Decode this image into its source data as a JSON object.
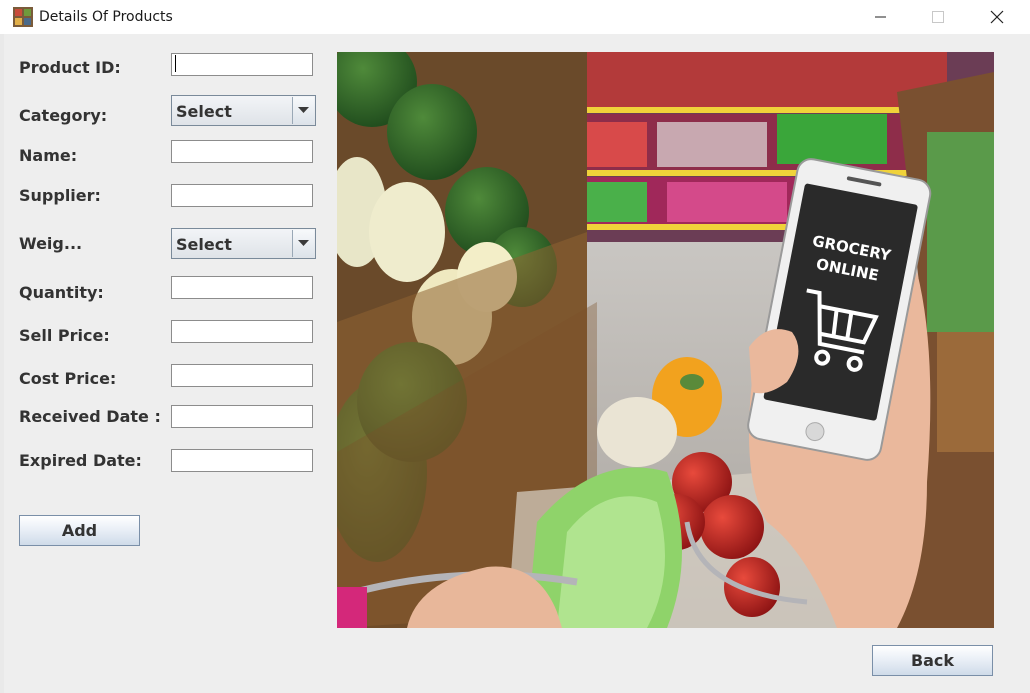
{
  "window": {
    "title": "Details Of Products",
    "icon": "grocery-app-icon",
    "controls": [
      "minimize",
      "maximize",
      "close"
    ]
  },
  "form": {
    "product_id": {
      "label": "Product ID:",
      "value": ""
    },
    "category": {
      "label": "Category:",
      "selected": "Select"
    },
    "name": {
      "label": "Name:",
      "value": ""
    },
    "supplier": {
      "label": "Supplier:",
      "value": ""
    },
    "weight": {
      "label": "Weig...",
      "selected": "Select"
    },
    "quantity": {
      "label": "Quantity:",
      "value": ""
    },
    "sell_price": {
      "label": "Sell Price:",
      "value": ""
    },
    "cost_price": {
      "label": "Cost Price:",
      "value": ""
    },
    "received_date": {
      "label": "Received Date :",
      "value": ""
    },
    "expired_date": {
      "label": "Expired Date:",
      "value": ""
    },
    "add_button": "Add"
  },
  "banner": {
    "phone_text_line1": "GROCERY",
    "phone_text_line2": "ONLINE"
  },
  "back_button": "Back"
}
